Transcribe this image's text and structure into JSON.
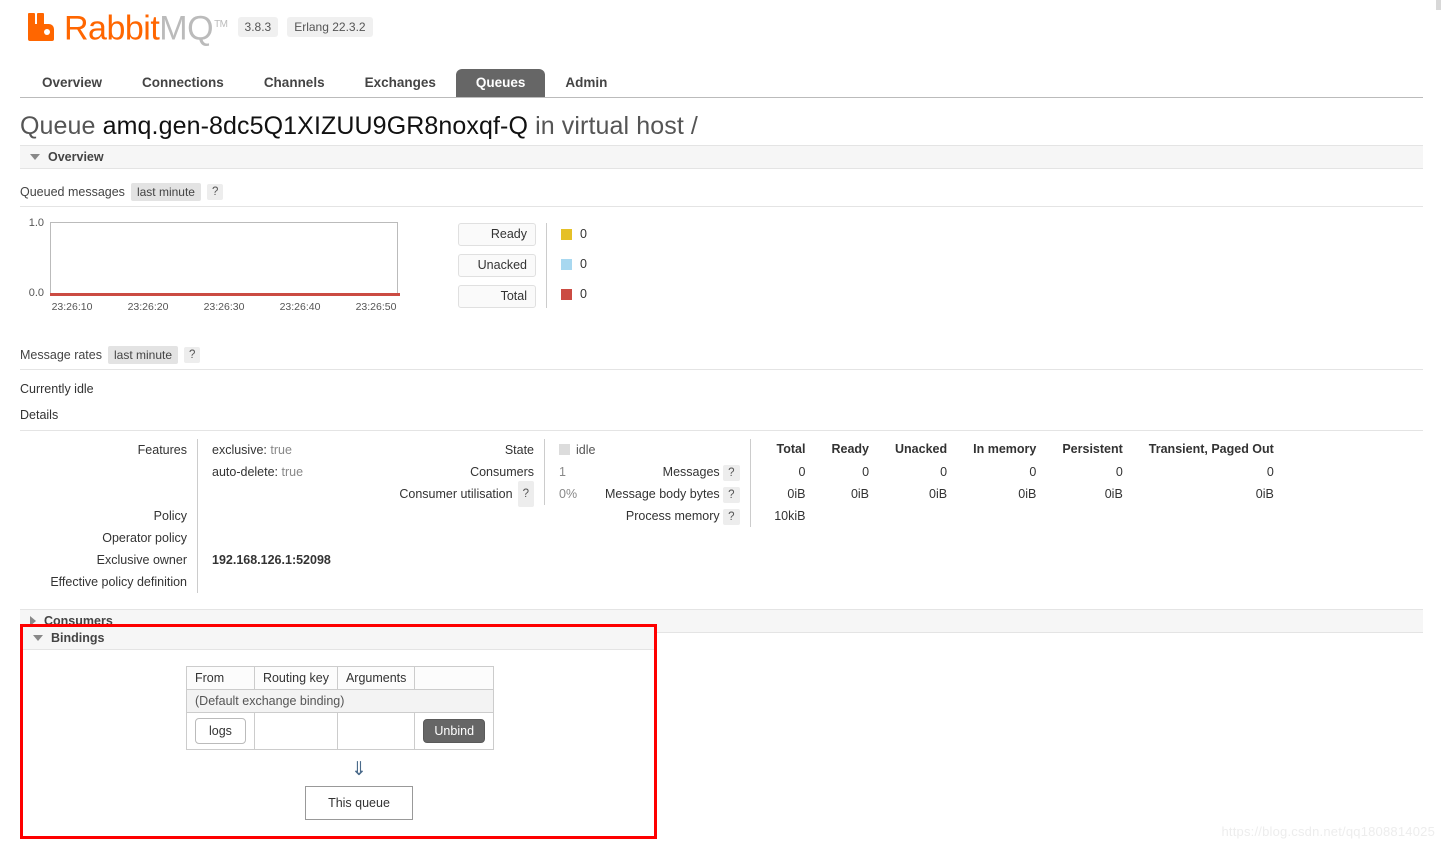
{
  "header": {
    "brand_rabbit": "Rabbit",
    "brand_mq": "MQ",
    "trademark": "TM",
    "version_badge": "3.8.3",
    "erlang_badge": "Erlang 22.3.2",
    "logo_icon": "rabbitmq-logo-icon",
    "brand_color": "#ff6600"
  },
  "tabs": [
    {
      "label": "Overview",
      "active": false
    },
    {
      "label": "Connections",
      "active": false
    },
    {
      "label": "Channels",
      "active": false
    },
    {
      "label": "Exchanges",
      "active": false
    },
    {
      "label": "Queues",
      "active": true
    },
    {
      "label": "Admin",
      "active": false
    }
  ],
  "page_title": {
    "prefix": "Queue",
    "queue_name": "amq.gen-8dc5Q1XIZUU9GR8noxqf-Q",
    "suffix": "in virtual host /"
  },
  "sections": {
    "overview": "Overview",
    "consumers": "Consumers",
    "bindings": "Bindings"
  },
  "queued_messages": {
    "label": "Queued messages",
    "range_chip": "last minute",
    "help": "?"
  },
  "message_rates": {
    "label": "Message rates",
    "range_chip": "last minute",
    "help": "?",
    "status": "Currently idle"
  },
  "details_heading": "Details",
  "chart_data": {
    "type": "line",
    "title": "Queued messages",
    "xlabel": "",
    "ylabel": "",
    "ylim": [
      0.0,
      1.0
    ],
    "ytick_labels": [
      "1.0",
      "0.0"
    ],
    "x": [
      "23:26:10",
      "23:26:20",
      "23:26:30",
      "23:26:40",
      "23:26:50"
    ],
    "grid": false,
    "legend_position": "right",
    "series": [
      {
        "name": "Ready",
        "color": "#e5c027",
        "current": "0",
        "values": [
          0,
          0,
          0,
          0,
          0
        ]
      },
      {
        "name": "Unacked",
        "color": "#a8d8f0",
        "current": "0",
        "values": [
          0,
          0,
          0,
          0,
          0
        ]
      },
      {
        "name": "Total",
        "color": "#cb4b42",
        "current": "0",
        "values": [
          0,
          0,
          0,
          0,
          0
        ]
      }
    ]
  },
  "details": {
    "features_label": "Features",
    "features": [
      {
        "key": "exclusive:",
        "value": "true"
      },
      {
        "key": "auto-delete:",
        "value": "true"
      }
    ],
    "policy_label": "Policy",
    "policy_value": "",
    "operator_policy_label": "Operator policy",
    "operator_policy_value": "",
    "exclusive_owner_label": "Exclusive owner",
    "exclusive_owner_value": "192.168.126.1:52098",
    "effective_policy_label": "Effective policy definition",
    "effective_policy_value": "",
    "state_label": "State",
    "state_value": "idle",
    "consumers_label": "Consumers",
    "consumers_value": "1",
    "consumer_utilisation_label": "Consumer utilisation",
    "consumer_utilisation_help": "?",
    "consumer_utilisation_value": "0%"
  },
  "messages_table": {
    "columns": [
      "Total",
      "Ready",
      "Unacked",
      "In memory",
      "Persistent",
      "Transient, Paged Out"
    ],
    "rows": [
      {
        "label": "Messages",
        "help": "?",
        "values": [
          "0",
          "0",
          "0",
          "0",
          "0",
          "0"
        ]
      },
      {
        "label": "Message body bytes",
        "help": "?",
        "values": [
          "0iB",
          "0iB",
          "0iB",
          "0iB",
          "0iB",
          "0iB"
        ]
      },
      {
        "label": "Process memory",
        "help": "?",
        "values": [
          "10kiB",
          "",
          "",
          "",
          "",
          ""
        ]
      }
    ]
  },
  "bindings": {
    "columns": [
      "From",
      "Routing key",
      "Arguments",
      ""
    ],
    "default_row": "(Default exchange binding)",
    "rows": [
      {
        "from": "logs",
        "routing_key": "",
        "arguments": "",
        "action": "Unbind"
      }
    ],
    "arrow": "⇓",
    "this_queue": "This queue"
  },
  "watermark": "https://blog.csdn.net/qq1808814025",
  "highlight_color": "#fe0000"
}
